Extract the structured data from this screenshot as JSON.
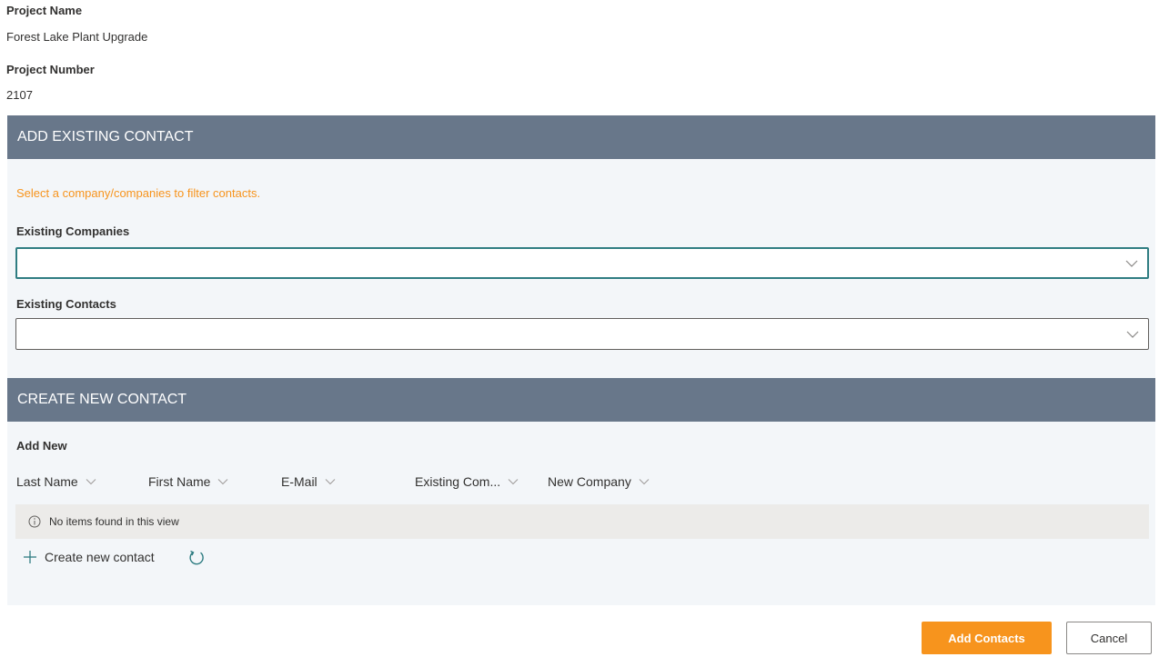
{
  "project": {
    "name_label": "Project Name",
    "name_value": "Forest Lake Plant Upgrade",
    "number_label": "Project Number",
    "number_value": "2107"
  },
  "existing_contact": {
    "header": "ADD EXISTING CONTACT",
    "hint": "Select a company/companies to filter contacts.",
    "companies_label": "Existing Companies",
    "companies_value": "",
    "contacts_label": "Existing Contacts",
    "contacts_value": ""
  },
  "new_contact": {
    "header": "CREATE NEW CONTACT",
    "add_new_label": "Add New",
    "columns": [
      "Last Name",
      "First Name",
      "E-Mail",
      "Existing Com...",
      "New Company"
    ],
    "empty_message": "No items found in this view",
    "create_link": "Create new contact"
  },
  "actions": {
    "primary": "Add Contacts",
    "secondary": "Cancel"
  },
  "colors": {
    "header_bg": "#68778a",
    "accent_orange": "#f7941d",
    "focus_teal": "#2f7d82",
    "section_bg": "#f3f6f9"
  },
  "icons": [
    "chevron-down-icon",
    "info-icon",
    "plus-icon",
    "refresh-icon"
  ]
}
